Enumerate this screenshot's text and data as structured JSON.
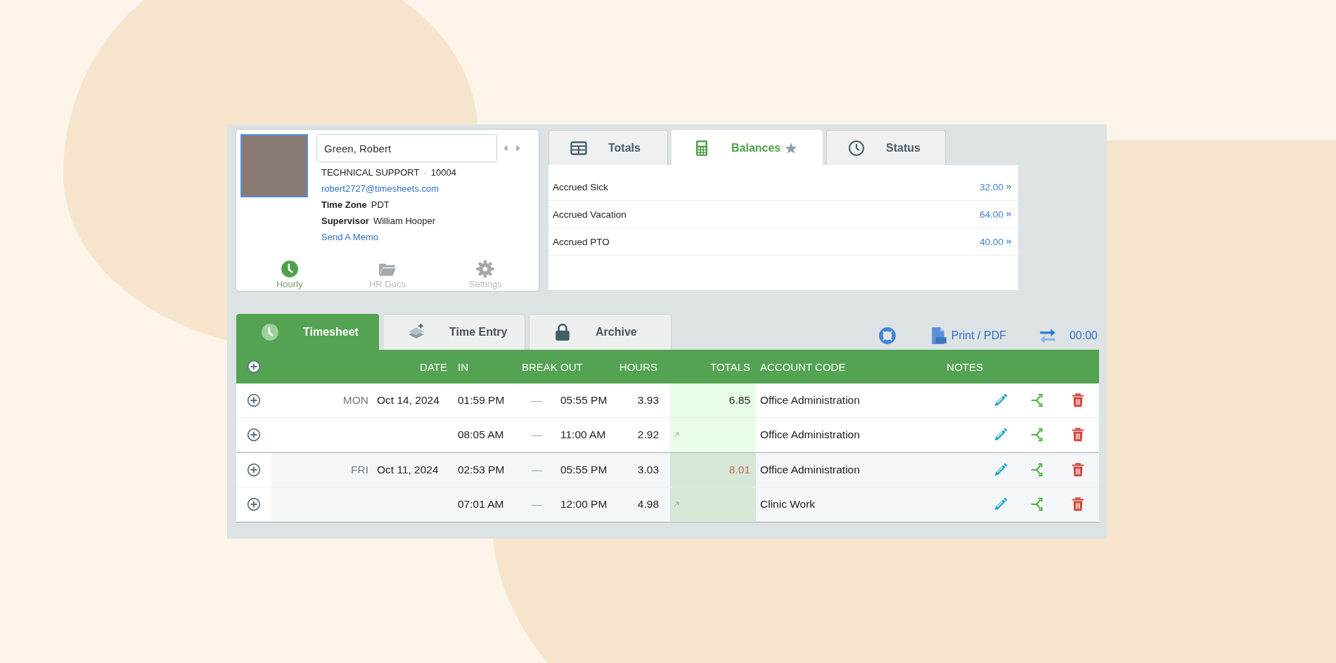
{
  "profile": {
    "name": "Green, Robert",
    "department": "TECHNICAL SUPPORT",
    "separator": "·",
    "employee_id": "10004",
    "email": "robert2727@timesheets.com",
    "time_zone": {
      "label": "Time Zone",
      "value": "PDT"
    },
    "supervisor": {
      "label": "Supervisor",
      "value": "William Hooper"
    },
    "memo_link": "Send A Memo",
    "nav": [
      {
        "kind": "clock",
        "label": "Hourly",
        "selected": true
      },
      {
        "kind": "folder",
        "label": "HR Docs",
        "selected": false
      },
      {
        "kind": "gear",
        "label": "Settings",
        "selected": false
      }
    ]
  },
  "summary_tabs": [
    {
      "kind": "table",
      "label": "Totals",
      "selected": false,
      "starred": false
    },
    {
      "kind": "calculator",
      "label": "Balances",
      "selected": true,
      "starred": true
    },
    {
      "kind": "clock",
      "label": "Status",
      "selected": false,
      "starred": false
    }
  ],
  "balances": [
    {
      "label": "Accrued Sick",
      "value": "32.00"
    },
    {
      "label": "Accrued Vacation",
      "value": "64.00"
    },
    {
      "label": "Accrued PTO",
      "value": "40.00"
    }
  ],
  "main_tabs": [
    {
      "kind": "clock",
      "label": "Timesheet",
      "selected": true
    },
    {
      "kind": "layers",
      "label": "Time Entry",
      "selected": false
    },
    {
      "kind": "lock",
      "label": "Archive",
      "selected": false
    }
  ],
  "toolbar": {
    "print": "Print / PDF",
    "timer": "00:00"
  },
  "table": {
    "columns": [
      "DATE",
      "IN",
      "BREAK",
      "OUT",
      "HOURS",
      "TOTALS",
      "ACCOUNT CODE",
      "NOTES"
    ],
    "days": [
      {
        "day": "MON",
        "date": "Oct 14, 2024",
        "total": "6.85",
        "overtime": false,
        "entries": [
          {
            "in": "01:59 PM",
            "break": "—",
            "out": "05:55 PM",
            "hours": "3.93",
            "account": "Office Administration"
          },
          {
            "in": "08:05 AM",
            "break": "—",
            "out": "11:00 AM",
            "hours": "2.92",
            "account": "Office Administration"
          }
        ]
      },
      {
        "day": "FRI",
        "date": "Oct 11, 2024",
        "total": "8.01",
        "overtime": true,
        "entries": [
          {
            "in": "02:53 PM",
            "break": "—",
            "out": "05:55 PM",
            "hours": "3.03",
            "account": "Office Administration"
          },
          {
            "in": "07:01 AM",
            "break": "—",
            "out": "12:00 PM",
            "hours": "4.98",
            "account": "Clinic Work"
          }
        ]
      }
    ]
  }
}
